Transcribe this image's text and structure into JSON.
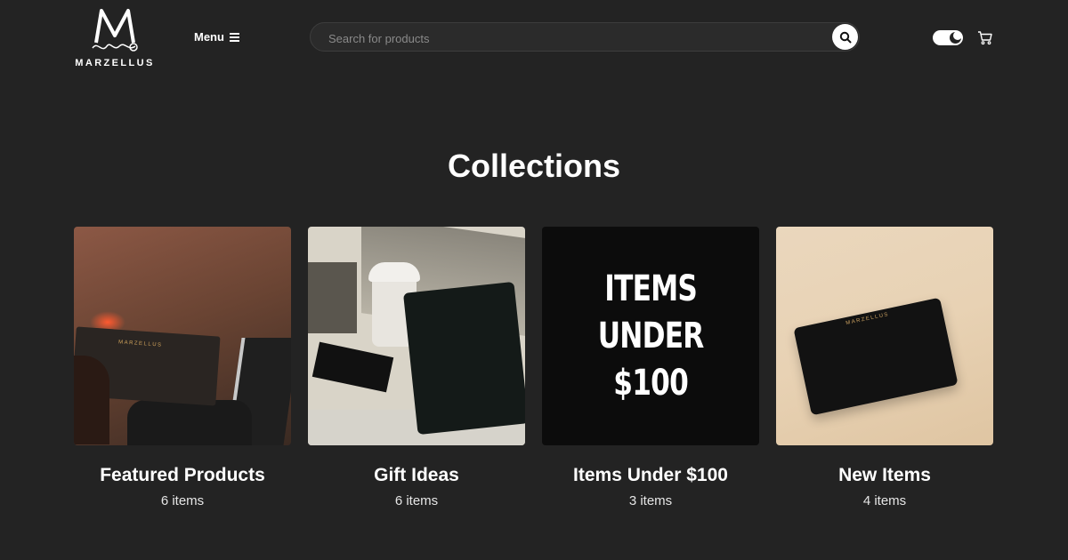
{
  "header": {
    "brand": "MARZELLUS",
    "menu_label": "Menu",
    "search_placeholder": "Search for products"
  },
  "page_title": "Collections",
  "collections": [
    {
      "name": "Featured Products",
      "count": "6 items"
    },
    {
      "name": "Gift Ideas",
      "count": "6 items"
    },
    {
      "name": "Items Under $100",
      "count": "3 items",
      "promo_lines": [
        "ITEMS",
        "UNDER",
        "$100"
      ]
    },
    {
      "name": "New Items",
      "count": "4 items"
    }
  ],
  "product_stamp": "MARZELLUS",
  "colors": {
    "background": "#232323",
    "text": "#ffffff",
    "search_bg": "#2b2b2b"
  },
  "icons": [
    "menu-hamburger-icon",
    "search-icon",
    "dark-mode-toggle",
    "cart-icon"
  ]
}
